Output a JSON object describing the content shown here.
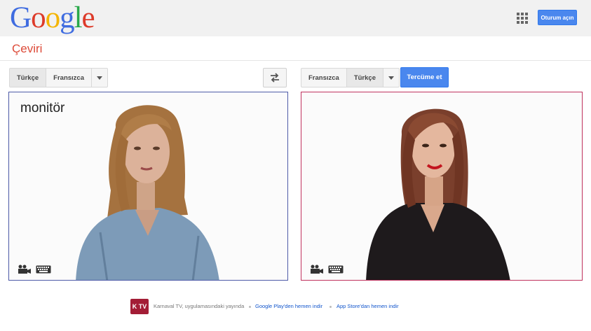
{
  "header": {
    "logo_letters": [
      {
        "ch": "G",
        "color": "#3f6ce0"
      },
      {
        "ch": "o",
        "color": "#dd3b2a"
      },
      {
        "ch": "o",
        "color": "#f4b400"
      },
      {
        "ch": "g",
        "color": "#3f6ce0"
      },
      {
        "ch": "l",
        "color": "#2aa84a"
      },
      {
        "ch": "e",
        "color": "#dd3b2a"
      }
    ],
    "signin_label": "Oturum açın",
    "apps_icon": "apps-grid-icon"
  },
  "section": {
    "title": "Çeviri"
  },
  "source": {
    "lang_1": "Türkçe",
    "lang_2": "Fransızca",
    "text": "monitör"
  },
  "swap_icon": "swap-arrows-icon",
  "target": {
    "lang_1": "Fransızca",
    "lang_2": "Türkçe",
    "translate_label": "Tercüme et"
  },
  "panel_icons": [
    "camera-icon",
    "keyboard-icon"
  ],
  "footer": {
    "brand_mark": "K TV",
    "text": "Karnaval TV, uygulamasındaki yayında",
    "link_1": "Google Play'den hemen indir",
    "link_2": "App Store'dan hemen indir"
  },
  "colors": {
    "accent_blue": "#4a87ee",
    "brand_red": "#dd4b39",
    "left_border": "#4d5aa7",
    "right_border": "#c0325e",
    "ktv_red": "#a31d36"
  }
}
